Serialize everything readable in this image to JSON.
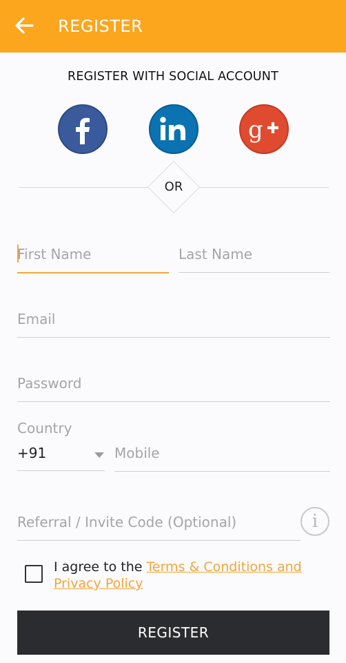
{
  "appbar": {
    "title": "REGISTER",
    "background": "#fba61d"
  },
  "social": {
    "heading": "REGISTER WITH SOCIAL ACCOUNT",
    "providers": [
      {
        "name": "facebook-icon",
        "glyph": "f",
        "color": "#3a5a9c"
      },
      {
        "name": "linkedin-icon",
        "glyph": "in",
        "color": "#0b73b2"
      },
      {
        "name": "google-plus-icon",
        "glyph": "g+",
        "color": "#e04b2f"
      }
    ]
  },
  "divider": {
    "label": "OR"
  },
  "form": {
    "first_name": {
      "placeholder": "First Name",
      "value": ""
    },
    "last_name": {
      "placeholder": "Last Name",
      "value": ""
    },
    "email": {
      "placeholder": "Email",
      "value": ""
    },
    "password": {
      "placeholder": "Password",
      "value": ""
    },
    "country": {
      "label": "Country",
      "value": "+91"
    },
    "mobile": {
      "placeholder": "Mobile",
      "value": ""
    },
    "referral": {
      "placeholder": "Referral / Invite Code (Optional)",
      "value": ""
    }
  },
  "agreement": {
    "text": "I agree to the ",
    "link": "Terms & Conditions and Privacy Policy",
    "checked": false
  },
  "register_button": {
    "label": "REGISTER"
  },
  "colors": {
    "accent": "#f3a63a",
    "button": "#2b2c2f"
  }
}
